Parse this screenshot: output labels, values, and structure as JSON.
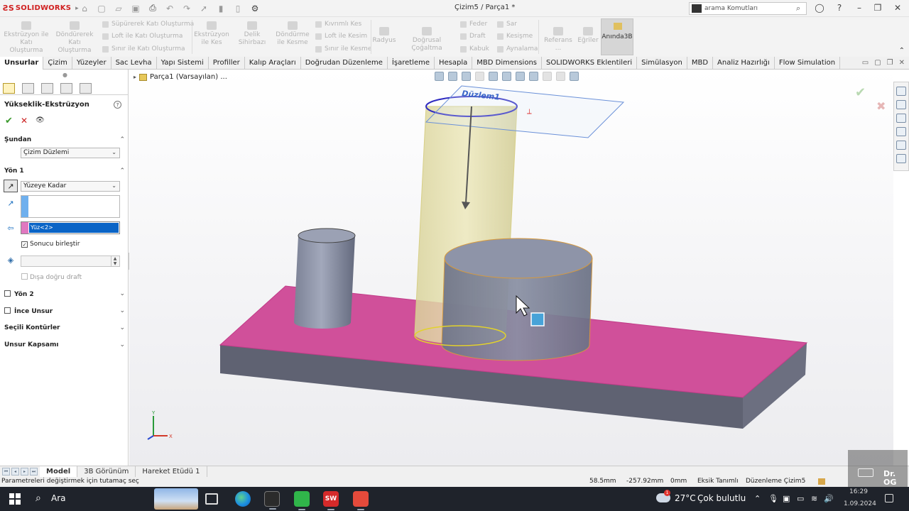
{
  "app": {
    "name": "SOLIDWORKS",
    "document_title": "Çizim5 / Parça1 *",
    "search_placeholder": "arama Komutları"
  },
  "ribbon": {
    "buttons": [
      {
        "label": "Ekstrüzyon ile Katı Oluşturma",
        "icon": "boss-extrude-icon"
      },
      {
        "label": "Döndürerek Katı Oluşturma",
        "icon": "revolve-icon"
      },
      {
        "label": "Ekstrüzyon ile Kes",
        "icon": "extruded-cut-icon"
      },
      {
        "label": "Delik Sihirbazı",
        "icon": "hole-wizard-icon"
      },
      {
        "label": "Döndürme ile Kesme",
        "icon": "revolved-cut-icon"
      },
      {
        "label": "Radyus",
        "icon": "fillet-icon"
      },
      {
        "label": "Doğrusal Çoğaltma",
        "icon": "linear-pattern-icon"
      },
      {
        "label": "Referans ...",
        "icon": "reference-geometry-icon"
      },
      {
        "label": "Eğriler",
        "icon": "curves-icon"
      }
    ],
    "small": {
      "sweep": "Süpürerek Katı Oluşturma",
      "loft": "Loft ile Katı Oluşturma",
      "boundary": "Sınır ile Katı Oluşturma",
      "swept_cut": "Kıvrımlı Kes",
      "loft_cut": "Loft ile Kesim",
      "boundary_cut": "Sınır ile Kesme",
      "rib": "Feder",
      "draft": "Draft",
      "shell": "Kabuk",
      "wrap": "Sar",
      "intersect": "Kesişme",
      "mirror": "Aynalama"
    },
    "instant3d": "Anında3B"
  },
  "tabs": [
    "Unsurlar",
    "Çizim",
    "Yüzeyler",
    "Sac Levha",
    "Yapı Sistemi",
    "Profiller",
    "Kalıp Araçları",
    "Doğrudan Düzenleme",
    "İşaretleme",
    "Hesapla",
    "MBD Dimensions",
    "SOLIDWORKS Eklentileri",
    "Simülasyon",
    "MBD",
    "Analiz Hazırlığı",
    "Flow Simulation"
  ],
  "property_manager": {
    "title": "Yükseklik-Ekstrüzyon",
    "from_label": "Şundan",
    "from_value": "Çizim Düzlemi",
    "dir1_label": "Yön 1",
    "dir1_end_condition": "Yüzeye Kadar",
    "face_selection": "Yüz<2>",
    "merge_result": "Sonucu birleştir",
    "merge_checked": true,
    "draft_outward": "Dışa doğru draft",
    "dir2_label": "Yön 2",
    "thin_feature": "İnce Unsur",
    "selected_contours": "Seçili Kontürler",
    "feature_scope": "Unsur Kapsamı"
  },
  "viewport": {
    "tree_item": "Parça1 (Varsayılan) ...",
    "plane_label": "Düzlem1",
    "triad": {
      "y": "Y",
      "x": "X"
    }
  },
  "bottom_tabs": [
    "Model",
    "3B Görünüm",
    "Hareket Etüdü 1"
  ],
  "statusbar": {
    "hint": "Parametreleri değiştirmek için tutamaç seç",
    "x": "58.5mm",
    "y": "-257.92mm",
    "z": "0mm",
    "definition": "Eksik Tanımlı",
    "mode": "Düzenleme Çizim5"
  },
  "taskbar": {
    "search": "Ara",
    "temperature": "27°C",
    "weather": "Çok bulutlu",
    "time": "16:29",
    "date": "1.09.2024",
    "badge": "1",
    "sw_label": "SW"
  },
  "watermark": "Dr. OG",
  "colors": {
    "accent_red": "#d02020",
    "face_pink": "#d0509a",
    "selection_blue": "#0a64c6",
    "preview_yellow": "#e5dc9a"
  }
}
